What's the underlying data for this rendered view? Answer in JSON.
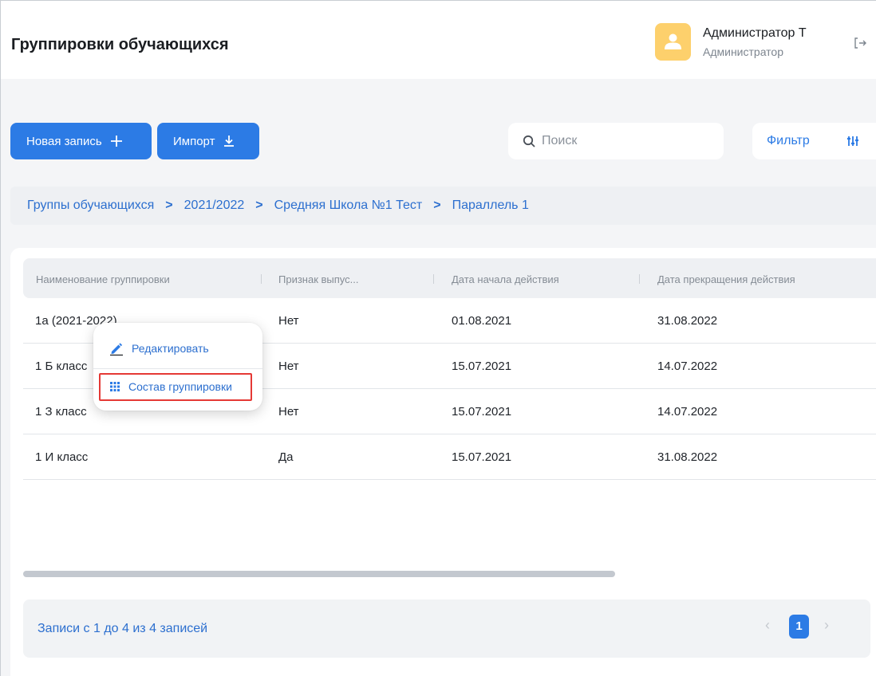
{
  "header": {
    "title": "Группировки обучающихся",
    "user_name": "Администратор Т",
    "user_role": "Администратор"
  },
  "toolbar": {
    "new_record_label": "Новая запись",
    "import_label": "Импорт",
    "search_placeholder": "Поиск",
    "filter_label": "Фильтр"
  },
  "breadcrumb": [
    "Группы обучающихся",
    "2021/2022",
    "Средняя Школа №1 Тест",
    "Параллель 1"
  ],
  "table": {
    "columns": [
      "Наименование группировки",
      "Признак выпус...",
      "Дата начала действия",
      "Дата прекращения действия"
    ],
    "rows": [
      [
        "1а (2021-2022)",
        "Нет",
        "01.08.2021",
        "31.08.2022"
      ],
      [
        "1 Б класс",
        "Нет",
        "15.07.2021",
        "14.07.2022"
      ],
      [
        "1 З класс",
        "Нет",
        "15.07.2021",
        "14.07.2022"
      ],
      [
        "1 И класс",
        "Да",
        "15.07.2021",
        "31.08.2022"
      ]
    ]
  },
  "context_menu": {
    "edit_label": "Редактировать",
    "compose_label": "Состав группировки"
  },
  "pagination": {
    "summary": "Записи с 1 до 4 из 4 записей",
    "current_page": "1",
    "prev": "‹",
    "next": "›"
  },
  "icons": {
    "avatar": "user-icon",
    "logout": "logout-icon",
    "new": "plus-icon",
    "import": "download-icon",
    "search": "search-icon",
    "filter": "sliders-icon",
    "edit": "pencil-icon",
    "compose": "grid-dots-icon"
  },
  "colors": {
    "accent": "#2c7be5",
    "avatar_bg": "#fdd06c",
    "highlight": "#e53935"
  }
}
